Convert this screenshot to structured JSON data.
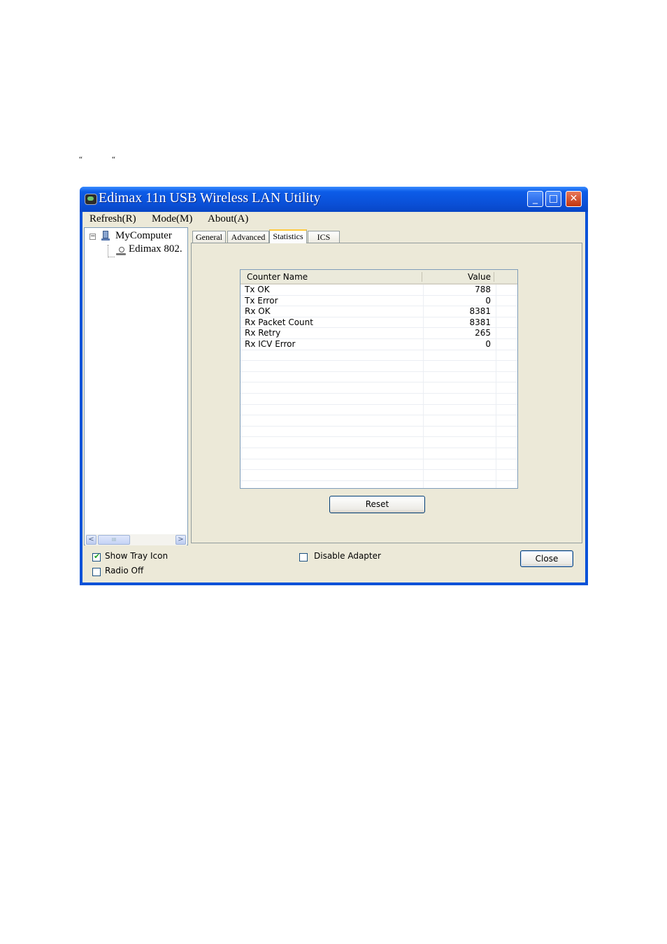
{
  "page": {
    "quote_left": "“",
    "quote_right": "“"
  },
  "window": {
    "title": "Edimax 11n USB Wireless LAN Utility",
    "minimize_glyph": "_",
    "maximize_glyph": "□",
    "close_glyph": "✕"
  },
  "menu": {
    "refresh": "Refresh(R)",
    "mode": "Mode(M)",
    "about": "About(A)"
  },
  "tree": {
    "expander": "−",
    "root": "MyComputer",
    "adapter": "Edimax 802.",
    "scroll_left": "<",
    "scroll_right": ">",
    "scroll_grip": "III"
  },
  "tabs": {
    "general": "General",
    "advanced": "Advanced",
    "statistics": "Statistics",
    "ics": "ICS",
    "active": "Statistics"
  },
  "stats": {
    "col_name": "Counter Name",
    "col_value": "Value",
    "rows": [
      {
        "name": "Tx OK",
        "value": "788"
      },
      {
        "name": "Tx Error",
        "value": "0"
      },
      {
        "name": "Rx OK",
        "value": "8381"
      },
      {
        "name": "Rx Packet Count",
        "value": "8381"
      },
      {
        "name": "Rx Retry",
        "value": "265"
      },
      {
        "name": "Rx ICV Error",
        "value": "0"
      }
    ],
    "reset": "Reset"
  },
  "options": {
    "show_tray_icon": {
      "label": "Show Tray Icon",
      "checked": true
    },
    "radio_off": {
      "label": "Radio Off",
      "checked": false
    },
    "disable_adapter": {
      "label": "Disable Adapter",
      "checked": false
    },
    "checkmark": "✔"
  },
  "close": "Close"
}
